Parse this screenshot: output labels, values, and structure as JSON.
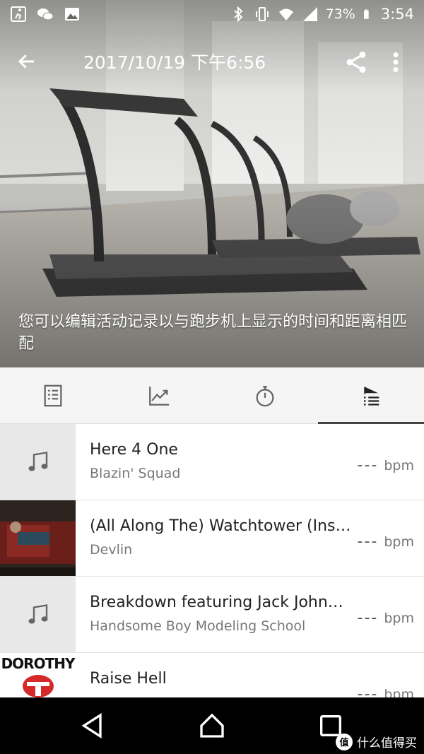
{
  "status_bar": {
    "battery": "73%",
    "time": "3:54"
  },
  "app_bar": {
    "title": "2017/10/19 下午6:56"
  },
  "hint": "您可以编辑活动记录以与跑步机上显示的时间和距离相匹配",
  "tabs": [
    {
      "icon": "list-icon"
    },
    {
      "icon": "chart-icon"
    },
    {
      "icon": "stopwatch-icon"
    },
    {
      "icon": "playlist-icon",
      "active": true
    }
  ],
  "tracks": [
    {
      "title": "Here 4 One",
      "artist": "Blazin' Squad",
      "bpm": "---",
      "unit": "bpm"
    },
    {
      "title": "(All Along The) Watchtower (Inst...",
      "artist": "Devlin",
      "bpm": "---",
      "unit": "bpm"
    },
    {
      "title": "Breakdown featuring Jack Johnson",
      "artist": "Handsome Boy Modeling School",
      "bpm": "---",
      "unit": "bpm"
    },
    {
      "title": "Raise Hell",
      "artist": "",
      "bpm": "---",
      "unit": "bpm",
      "cover_text": "DOROTHY"
    }
  ],
  "watermark": {
    "badge": "值",
    "text": "什么值得买"
  }
}
